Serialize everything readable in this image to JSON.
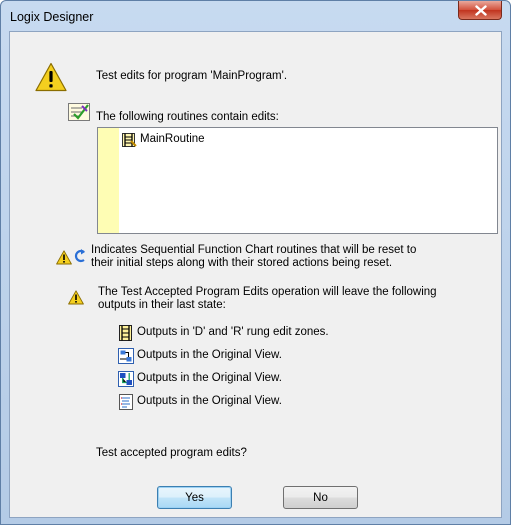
{
  "window": {
    "title": "Logix Designer",
    "close_icon": "close-icon"
  },
  "header": {
    "message": "Test edits for program 'MainProgram'.",
    "icon": "warning-icon"
  },
  "routines": {
    "heading": "The following routines contain edits:",
    "heading_icon": "routine-edits-icon",
    "items": [
      {
        "label": "MainRoutine",
        "icon": "ladder-routine-icon"
      }
    ]
  },
  "sfc_note": {
    "lines": [
      "Indicates Sequential Function Chart routines that will be reset to",
      "their initial steps along with their stored actions being reset."
    ]
  },
  "outputs_note": {
    "lines": [
      "The Test Accepted Program Edits operation will leave the following",
      "outputs in their last state:"
    ],
    "items": [
      {
        "label": "Outputs in 'D' and 'R' rung edit zones.",
        "icon": "ladder-rung-icon"
      },
      {
        "label": "Outputs in the Original View.",
        "icon": "function-block-icon"
      },
      {
        "label": "Outputs in the Original View.",
        "icon": "sfc-routine-icon"
      },
      {
        "label": "Outputs in the Original View.",
        "icon": "structured-text-icon"
      }
    ]
  },
  "question": "Test accepted program edits?",
  "buttons": {
    "yes": "Yes",
    "no": "No"
  },
  "colors": {
    "titlebar": "#c7daf0",
    "dialog_bg": "#f0f0f0",
    "list_gutter": "#fefdb4",
    "close_button": "#c9422b",
    "warning": "#f4cf1f"
  }
}
